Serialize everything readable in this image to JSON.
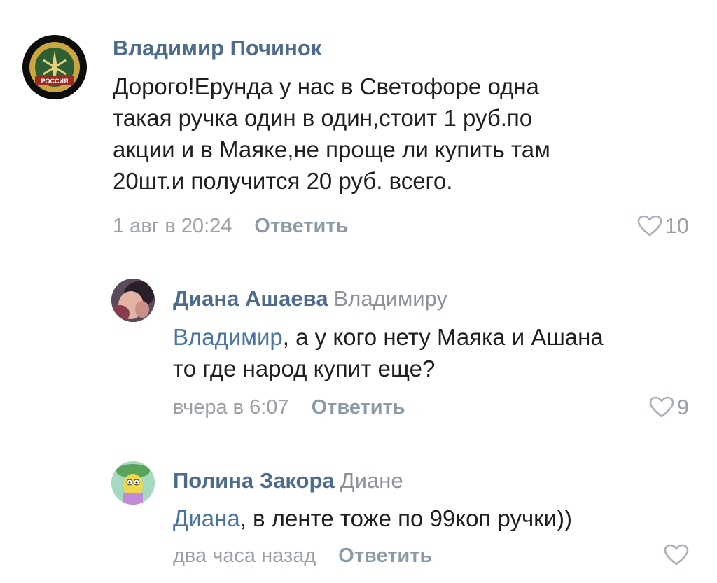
{
  "comments": [
    {
      "author": "Владимир Починок",
      "reply_to": "",
      "text_lines": [
        "Дорого!Ерунда у нас в Светофоре одна",
        "такая ручка один в один,стоит 1 руб.по",
        "акции и в Маяке,не проще ли купить там",
        "20шт.и получится 20 руб. всего."
      ],
      "time": "1 авг в 20:24",
      "reply_label": "Ответить",
      "likes": "10",
      "avatar_text": "РОССИЯ",
      "avatar_icon": "military-emblem-icon"
    },
    {
      "author": "Диана Ашаева",
      "reply_to": "Владимиру",
      "mention": "Владимир",
      "text_rest": ", а у кого нету Маяка и Ашана",
      "text_line2": "то где народ купит еще?",
      "time": "вчера в 6:07",
      "reply_label": "Ответить",
      "likes": "9",
      "avatar_icon": "profile-photo-icon"
    },
    {
      "author": "Полина Закора",
      "reply_to": "Диане",
      "mention": "Диана",
      "text_rest": ", в ленте тоже по 99коп ручки))",
      "time": "два часа назад",
      "reply_label": "Ответить",
      "likes": "",
      "avatar_icon": "cartoon-avatar-icon"
    }
  ],
  "colors": {
    "author": "#4d6b8f",
    "mention": "#4a73a3",
    "meta": "#9aa0a6",
    "heart": "#a9b0b8"
  }
}
